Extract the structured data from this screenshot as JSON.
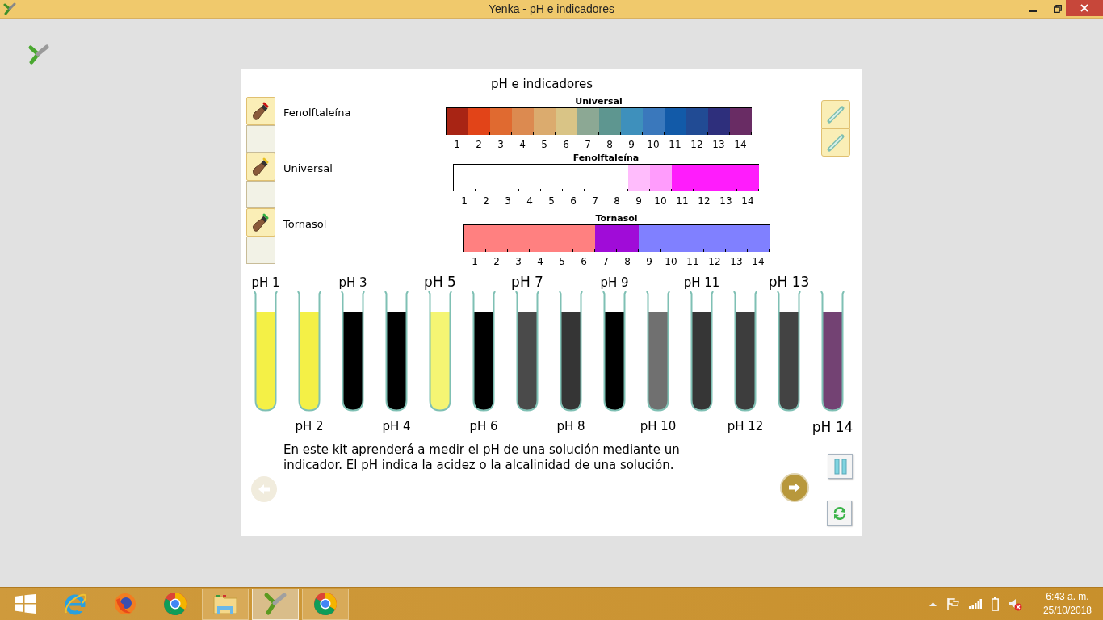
{
  "window": {
    "title": "Yenka - pH e indicadores"
  },
  "panel": {
    "title": "pH e indicadores",
    "indicators": [
      {
        "label": "Fenolftaleína",
        "color": "#cc1010"
      },
      {
        "label": "Universal",
        "color": "#e8c020"
      },
      {
        "label": "Tornasol",
        "color": "#30b040"
      }
    ],
    "scales": [
      {
        "title": "Universal",
        "cells": [
          {
            "label": "1",
            "color": "#a82414"
          },
          {
            "label": "2",
            "color": "#e24418"
          },
          {
            "label": "3",
            "color": "#e06a30"
          },
          {
            "label": "4",
            "color": "#dc8a50"
          },
          {
            "label": "5",
            "color": "#dbab6e"
          },
          {
            "label": "6",
            "color": "#d9c486"
          },
          {
            "label": "7",
            "color": "#8ca894"
          },
          {
            "label": "8",
            "color": "#5e9690"
          },
          {
            "label": "9",
            "color": "#3e90bc"
          },
          {
            "label": "10",
            "color": "#3a78bc"
          },
          {
            "label": "11",
            "color": "#125aa8"
          },
          {
            "label": "12",
            "color": "#214b94"
          },
          {
            "label": "13",
            "color": "#2e2f7c"
          },
          {
            "label": "14",
            "color": "#692c64"
          }
        ]
      },
      {
        "title": "Fenolftaleína",
        "cells": [
          {
            "label": "1",
            "color": "#ffffff"
          },
          {
            "label": "2",
            "color": "#ffffff"
          },
          {
            "label": "3",
            "color": "#ffffff"
          },
          {
            "label": "4",
            "color": "#ffffff"
          },
          {
            "label": "5",
            "color": "#ffffff"
          },
          {
            "label": "6",
            "color": "#ffffff"
          },
          {
            "label": "7",
            "color": "#ffffff"
          },
          {
            "label": "8",
            "color": "#ffffff"
          },
          {
            "label": "9",
            "color": "#ffbcfc"
          },
          {
            "label": "10",
            "color": "#ff9cfc"
          },
          {
            "label": "11",
            "color": "#ff1cfc"
          },
          {
            "label": "12",
            "color": "#ff1cfc"
          },
          {
            "label": "13",
            "color": "#ff1cfc"
          },
          {
            "label": "14",
            "color": "#ff1cfc"
          }
        ]
      },
      {
        "title": "Tornasol",
        "cells": [
          {
            "label": "1",
            "color": "#ff8080"
          },
          {
            "label": "2",
            "color": "#ff8080"
          },
          {
            "label": "3",
            "color": "#ff8080"
          },
          {
            "label": "4",
            "color": "#ff8080"
          },
          {
            "label": "5",
            "color": "#ff8080"
          },
          {
            "label": "6",
            "color": "#ff8080"
          },
          {
            "label": "7",
            "color": "#a00cd8"
          },
          {
            "label": "8",
            "color": "#a00cd8"
          },
          {
            "label": "9",
            "color": "#8080ff"
          },
          {
            "label": "10",
            "color": "#8080ff"
          },
          {
            "label": "11",
            "color": "#8080ff"
          },
          {
            "label": "12",
            "color": "#8080ff"
          },
          {
            "label": "13",
            "color": "#8080ff"
          },
          {
            "label": "14",
            "color": "#8080ff"
          }
        ]
      }
    ],
    "tubes": [
      {
        "label": "pH 1",
        "color": "#f4f046",
        "emphasized": false
      },
      {
        "label": "pH 2",
        "color": "#f4f046",
        "emphasized": false
      },
      {
        "label": "pH 3",
        "color": "#000000",
        "emphasized": false
      },
      {
        "label": "pH 4",
        "color": "#000000",
        "emphasized": false
      },
      {
        "label": "pH 5",
        "color": "#f5f573",
        "emphasized": true
      },
      {
        "label": "pH 6",
        "color": "#000000",
        "emphasized": false
      },
      {
        "label": "pH 7",
        "color": "#4a4a4a",
        "emphasized": true
      },
      {
        "label": "pH 8",
        "color": "#353535",
        "emphasized": false
      },
      {
        "label": "pH 9",
        "color": "#000000",
        "emphasized": false
      },
      {
        "label": "pH 10",
        "color": "#707070",
        "emphasized": false
      },
      {
        "label": "pH 11",
        "color": "#363636",
        "emphasized": false
      },
      {
        "label": "pH 12",
        "color": "#3d3d3d",
        "emphasized": false
      },
      {
        "label": "pH 13",
        "color": "#434343",
        "emphasized": true
      },
      {
        "label": "pH 14",
        "color": "#734273",
        "emphasized": true
      }
    ],
    "description": "En este kit aprenderá a medir el pH de una solución mediante un indicador. El pH indica la acidez o la alcalinidad de una solución.",
    "back_button": {
      "disabled": true
    },
    "forward_button": {
      "disabled": false
    }
  },
  "taskbar": {
    "apps": [
      {
        "kind": "start",
        "open": false,
        "selected": false
      },
      {
        "kind": "ie",
        "open": false,
        "selected": false
      },
      {
        "kind": "firefox",
        "open": false,
        "selected": false
      },
      {
        "kind": "chrome",
        "open": false,
        "selected": false
      },
      {
        "kind": "explorer",
        "open": true,
        "selected": false
      },
      {
        "kind": "yenka",
        "open": true,
        "selected": true
      },
      {
        "kind": "chrome",
        "open": true,
        "selected": false
      }
    ],
    "time": "6:43 a. m.",
    "date": "25/10/2018"
  }
}
